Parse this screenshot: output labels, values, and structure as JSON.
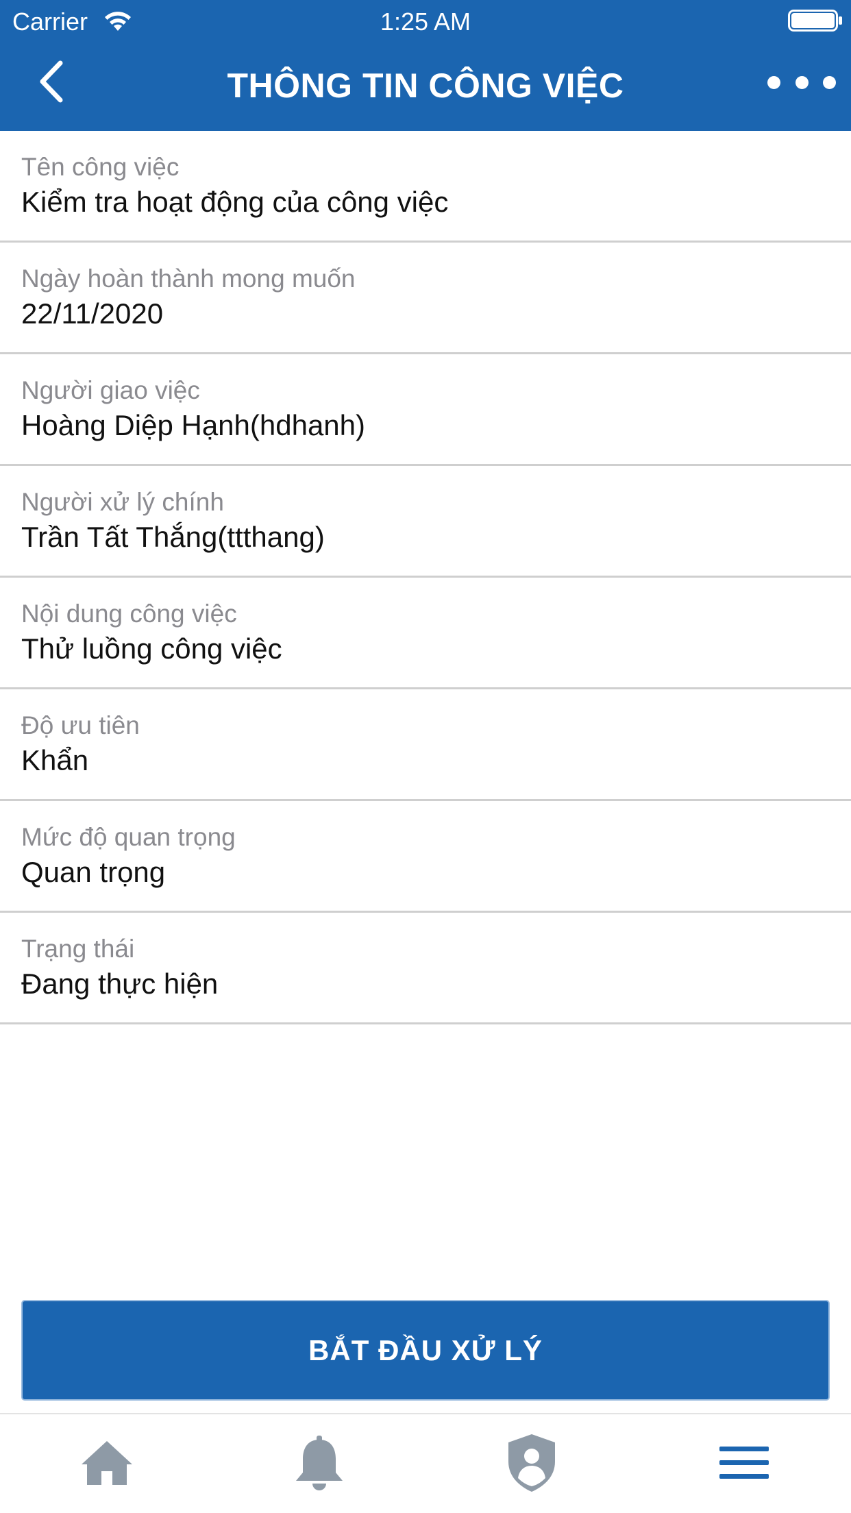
{
  "status_bar": {
    "carrier": "Carrier",
    "time": "1:25 AM",
    "icons": [
      "wifi-icon",
      "battery-icon"
    ]
  },
  "header": {
    "title": "THÔNG TIN CÔNG VIỆC",
    "back_icon": "chevron-left-icon",
    "more_icon": "more-dots-icon",
    "background_color": "#1b65b0"
  },
  "fields": [
    {
      "label": "Tên công việc",
      "value": "Kiểm tra hoạt động của công việc"
    },
    {
      "label": "Ngày hoàn thành mong muốn",
      "value": "22/11/2020"
    },
    {
      "label": "Người giao việc",
      "value": "Hoàng Diệp Hạnh(hdhanh)"
    },
    {
      "label": "Người xử lý chính",
      "value": "Trần Tất Thắng(ttthang)"
    },
    {
      "label": "Nội dung công việc",
      "value": "Thử luồng công việc"
    },
    {
      "label": "Độ ưu tiên",
      "value": "Khẩn"
    },
    {
      "label": "Mức độ quan trọng",
      "value": "Quan trọng"
    },
    {
      "label": "Trạng thái",
      "value": "Đang thực hiện"
    }
  ],
  "action": {
    "start_label": "BẮT ĐẦU XỬ LÝ"
  },
  "tab_bar": {
    "tabs": [
      {
        "icon": "home-icon",
        "active": false
      },
      {
        "icon": "bell-icon",
        "active": false
      },
      {
        "icon": "shield-user-icon",
        "active": false
      },
      {
        "icon": "menu-icon",
        "active": true
      }
    ],
    "active_color": "#1b65b0",
    "inactive_color": "#8e9aa6"
  }
}
